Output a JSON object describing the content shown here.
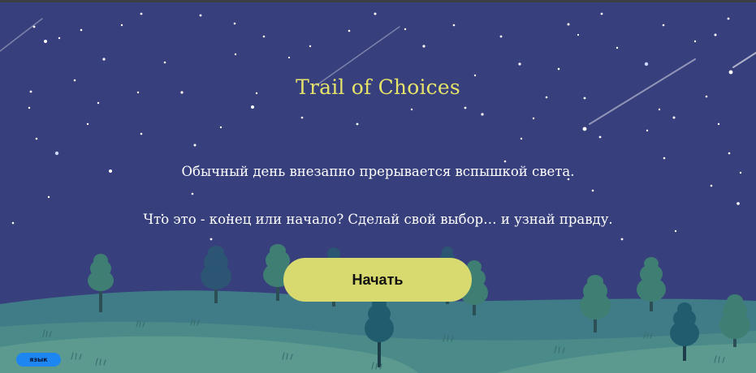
{
  "game": {
    "title": "Trail of Choices",
    "intro_line_1": "Обычный день внезапно прерывается вспышкой света.",
    "intro_line_2": "Что это - конец или начало? Сделай свой выбор… и узнай правду.",
    "start_label": "Начать",
    "language_label": "язык"
  },
  "colors": {
    "sky": "#373f7c",
    "title": "#e6e36a",
    "start_button": "#d8d96e",
    "language_button": "#1e86f0",
    "hill_back": "#3f7c87",
    "hill_mid": "#4a8a88",
    "hill_front": "#5c9a90"
  },
  "icons": [
    "star-icon",
    "shooting-star-icon",
    "tree-icon",
    "grass-tuft-icon"
  ]
}
